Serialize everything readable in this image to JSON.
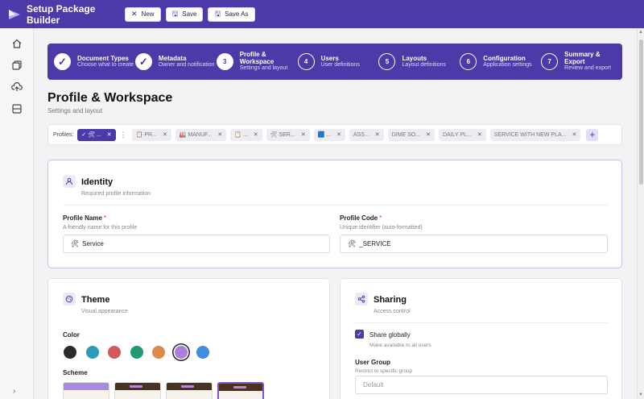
{
  "app": {
    "title": "Setup Package Builder"
  },
  "toolbar": {
    "new_label": "New",
    "save_label": "Save",
    "save_as_label": "Save As"
  },
  "rail": {
    "icons": [
      "home-icon",
      "copy-icon",
      "cloud-upload-icon",
      "layout-icon"
    ],
    "expand": "›"
  },
  "steps": [
    {
      "num": "✓",
      "title": "Document Types",
      "subtitle": "Choose what to create",
      "state": "done"
    },
    {
      "num": "✓",
      "title": "Metadata",
      "subtitle": "Owner and notification",
      "state": "done"
    },
    {
      "num": "3",
      "title": "Profile & Workspace",
      "subtitle": "Settings and layout",
      "state": "active"
    },
    {
      "num": "4",
      "title": "Users",
      "subtitle": "User definitions",
      "state": "todo"
    },
    {
      "num": "5",
      "title": "Layouts",
      "subtitle": "Layout definitions",
      "state": "todo"
    },
    {
      "num": "6",
      "title": "Configuration",
      "subtitle": "Application settings",
      "state": "todo"
    },
    {
      "num": "7",
      "title": "Summary & Export",
      "subtitle": "Review and export",
      "state": "todo"
    }
  ],
  "page": {
    "title": "Profile & Workspace",
    "subtitle": "Settings and layout"
  },
  "profiles": {
    "label": "Profiles:",
    "tabs": [
      {
        "label": "✓ 🛠 ...",
        "active": true
      },
      {
        "label": "📋 PR...",
        "active": false
      },
      {
        "label": "🏭 MANUF...",
        "active": false
      },
      {
        "label": "📋 ...",
        "active": false
      },
      {
        "label": "🛠 SER...",
        "active": false
      },
      {
        "label": "🟦 ...",
        "active": false
      },
      {
        "label": "ASS...",
        "active": false
      },
      {
        "label": "DIME SO...",
        "active": false
      },
      {
        "label": "DAILY PL...",
        "active": false
      },
      {
        "label": "SERVICE WITH NEW PLA...",
        "active": false
      }
    ],
    "add": "+"
  },
  "identity": {
    "title": "Identity",
    "subtitle": "Required profile information",
    "profile_name": {
      "label": "Profile Name",
      "required": "*",
      "help": "A friendly name for this profile",
      "prefix": "🛠",
      "value": "Service"
    },
    "profile_code": {
      "label": "Profile Code",
      "required": "*",
      "help": "Unique identifier (auto-formatted)",
      "prefix": "🛠",
      "value": "_SERVICE"
    }
  },
  "theme": {
    "title": "Theme",
    "subtitle": "Visual appearance",
    "color_label": "Color",
    "colors": [
      "#2b2b2b",
      "#2b9cb8",
      "#d05a5a",
      "#1f9a73",
      "#dc8a4a",
      "#a87ee0",
      "#3d8ee0"
    ],
    "selected_color_index": 5,
    "scheme_label": "Scheme",
    "schemes": [
      {
        "bar": "#a989e0"
      },
      {
        "bar": "#4a3220"
      },
      {
        "bar": "#4a3220"
      },
      {
        "bar": "#4a3220"
      }
    ]
  },
  "sharing": {
    "title": "Sharing",
    "subtitle": "Access control",
    "share_globally": {
      "label": "Share globally",
      "help": "Make available to all users",
      "checked": true
    },
    "user_group": {
      "label": "User Group",
      "help": "Restrict to specific group",
      "placeholder": "Default"
    }
  }
}
